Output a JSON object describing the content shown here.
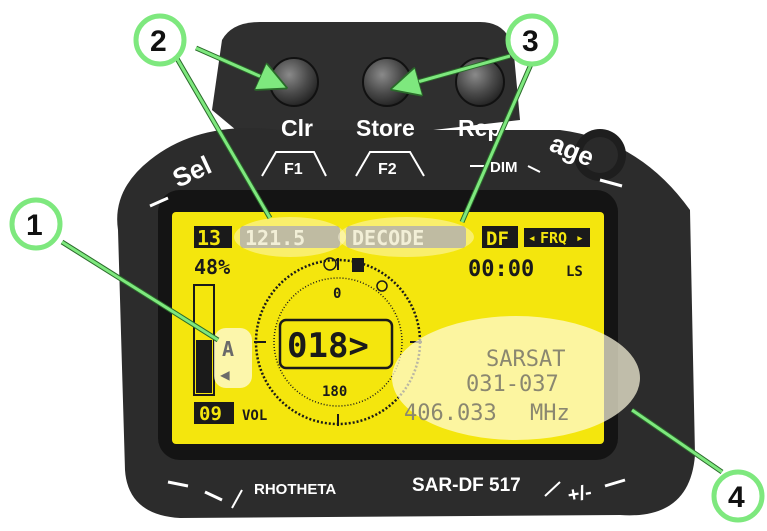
{
  "colors": {
    "bezel": "#2b2b2b",
    "lcd_background": "#f4e60d",
    "lcd_ink": "#1a1a1a",
    "callout_green": "#7ee87e",
    "highlight": "#fffbe0"
  },
  "buttons": {
    "clr": {
      "label": "Clr",
      "function_key": "F1"
    },
    "store": {
      "label": "Store",
      "function_key": "F2"
    },
    "rep": {
      "label": "Rep"
    }
  },
  "panel_labels": {
    "left_arc": "Sel",
    "dim": "DIM",
    "right_arc": "age",
    "brand": "RHOTHETA",
    "model": "SAR-DF 517"
  },
  "lcd": {
    "channel_badge": "13",
    "frequency_mode": "121.5",
    "decode_mode": "DECODE",
    "df_badge": "DF",
    "freq_selector": "FRQ",
    "signal_percent": "48%",
    "timer": "00:00",
    "timer_suffix": "LS",
    "bearing": "018>",
    "compass_north": "0",
    "compass_south": "180",
    "antenna_mode": "A",
    "volume_value": "09",
    "volume_label": "VOL",
    "target_name": "SARSAT",
    "target_id": "031-037",
    "target_frequency": "406.033",
    "target_unit": "MHz"
  },
  "callouts": [
    "1",
    "2",
    "3",
    "4"
  ]
}
